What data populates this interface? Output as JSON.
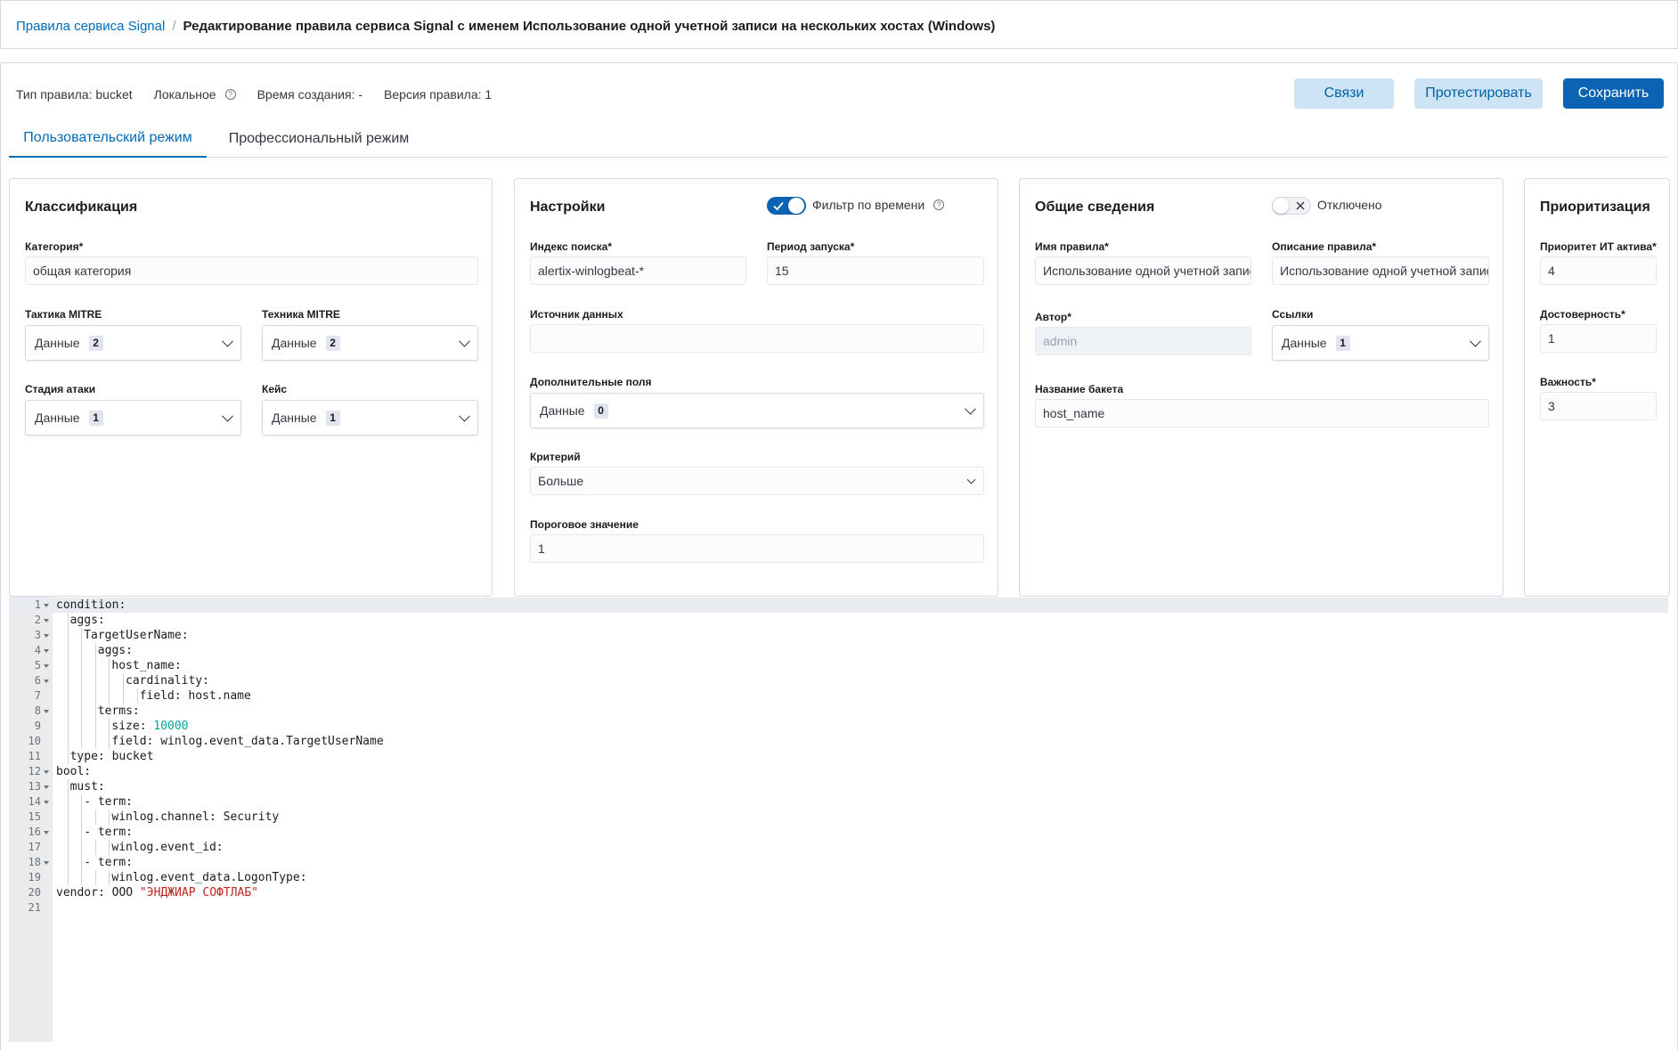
{
  "breadcrumb": {
    "link": "Правила сервиса Signal",
    "separator": "/",
    "current": "Редактирование правила сервиса Signal с именем Использование одной учетной записи на нескольких хостах (Windows)"
  },
  "meta": {
    "rule_type": "Тип правила: bucket",
    "local": "Локальное",
    "created": "Время создания: -",
    "version": "Версия правила: 1"
  },
  "buttons": {
    "links": "Связи",
    "test": "Протестировать",
    "save": "Сохранить"
  },
  "tabs": [
    {
      "label": "Пользовательский режим",
      "active": true
    },
    {
      "label": "Профессиональный режим",
      "active": false
    }
  ],
  "classification": {
    "title": "Классификация",
    "category_label": "Категория*",
    "category_value": "общая категория",
    "tactic_label": "Тактика MITRE",
    "tactic_value": "Данные",
    "tactic_count": "2",
    "technique_label": "Техника MITRE",
    "technique_value": "Данные",
    "technique_count": "2",
    "stage_label": "Стадия атаки",
    "stage_value": "Данные",
    "stage_count": "1",
    "case_label": "Кейс",
    "case_value": "Данные",
    "case_count": "1"
  },
  "settings": {
    "title": "Настройки",
    "time_filter_label": "Фильтр по времени",
    "time_filter_on": true,
    "index_label": "Индекс поиска*",
    "index_value": "alertix-winlogbeat-*",
    "period_label": "Период запуска*",
    "period_value": "15",
    "source_label": "Источник данных",
    "source_value": "",
    "extra_label": "Дополнительные поля",
    "extra_value": "Данные",
    "extra_count": "0",
    "criterion_label": "Критерий",
    "criterion_value": "Больше",
    "threshold_label": "Пороговое значение",
    "threshold_value": "1"
  },
  "general": {
    "title": "Общие сведения",
    "status_label": "Отключено",
    "status_on": false,
    "name_label": "Имя правила*",
    "name_value": "Использование одной учетной записи на нескольких хостах (Windows)",
    "desc_label": "Описание правила*",
    "desc_value": "Использование одной учетной записи на нескольких хостах (Windows)",
    "author_label": "Автор*",
    "author_value": "admin",
    "links_label": "Ссылки",
    "links_value": "Данные",
    "links_count": "1",
    "bucket_label": "Название бакета",
    "bucket_value": "host_name"
  },
  "priority": {
    "title": "Приоритизация",
    "asset_label": "Приоритет ИТ актива*",
    "asset_value": "4",
    "confidence_label": "Достоверность*",
    "confidence_value": "1",
    "importance_label": "Важность*",
    "importance_value": "3"
  },
  "code": {
    "lines": [
      {
        "n": "1",
        "indent": 0,
        "fold": true,
        "key": "condition:",
        "val": "",
        "vt": ""
      },
      {
        "n": "2",
        "indent": 1,
        "fold": true,
        "key": "aggs:",
        "val": "",
        "vt": ""
      },
      {
        "n": "3",
        "indent": 2,
        "fold": true,
        "key": "TargetUserName:",
        "val": "",
        "vt": ""
      },
      {
        "n": "4",
        "indent": 3,
        "fold": true,
        "key": "aggs:",
        "val": "",
        "vt": ""
      },
      {
        "n": "5",
        "indent": 4,
        "fold": true,
        "key": "host_name:",
        "val": "",
        "vt": ""
      },
      {
        "n": "6",
        "indent": 5,
        "fold": true,
        "key": "cardinality:",
        "val": "",
        "vt": ""
      },
      {
        "n": "7",
        "indent": 6,
        "fold": false,
        "key": "field: ",
        "val": "host.name",
        "vt": ""
      },
      {
        "n": "8",
        "indent": 3,
        "fold": true,
        "key": "terms:",
        "val": "",
        "vt": ""
      },
      {
        "n": "9",
        "indent": 4,
        "fold": false,
        "key": "size: ",
        "val": "10000",
        "vt": "num"
      },
      {
        "n": "10",
        "indent": 4,
        "fold": false,
        "key": "field: ",
        "val": "winlog.event_data.TargetUserName",
        "vt": ""
      },
      {
        "n": "11",
        "indent": 1,
        "fold": false,
        "key": "type: ",
        "val": "bucket",
        "vt": ""
      },
      {
        "n": "12",
        "indent": 0,
        "fold": true,
        "key": "bool:",
        "val": "",
        "vt": ""
      },
      {
        "n": "13",
        "indent": 1,
        "fold": true,
        "key": "must:",
        "val": "",
        "vt": ""
      },
      {
        "n": "14",
        "indent": 2,
        "fold": true,
        "key": "- term:",
        "val": "",
        "vt": ""
      },
      {
        "n": "15",
        "indent": 4,
        "fold": false,
        "key": "winlog.channel: ",
        "val": "Security",
        "vt": ""
      },
      {
        "n": "16",
        "indent": 2,
        "fold": true,
        "key": "- term:",
        "val": "",
        "vt": ""
      },
      {
        "n": "17",
        "indent": 4,
        "fold": false,
        "key": "winlog.event_id:",
        "val": "",
        "vt": ""
      },
      {
        "n": "18",
        "indent": 2,
        "fold": true,
        "key": "- term:",
        "val": "",
        "vt": ""
      },
      {
        "n": "19",
        "indent": 4,
        "fold": false,
        "key": "winlog.event_data.LogonType:",
        "val": "",
        "vt": ""
      },
      {
        "n": "20",
        "indent": 0,
        "fold": false,
        "key": "vendor: ООО ",
        "val": "\"ЭНДЖИАР СОФТЛАБ\"",
        "vt": "str"
      },
      {
        "n": "21",
        "indent": 0,
        "fold": false,
        "key": "",
        "val": "",
        "vt": ""
      }
    ]
  }
}
